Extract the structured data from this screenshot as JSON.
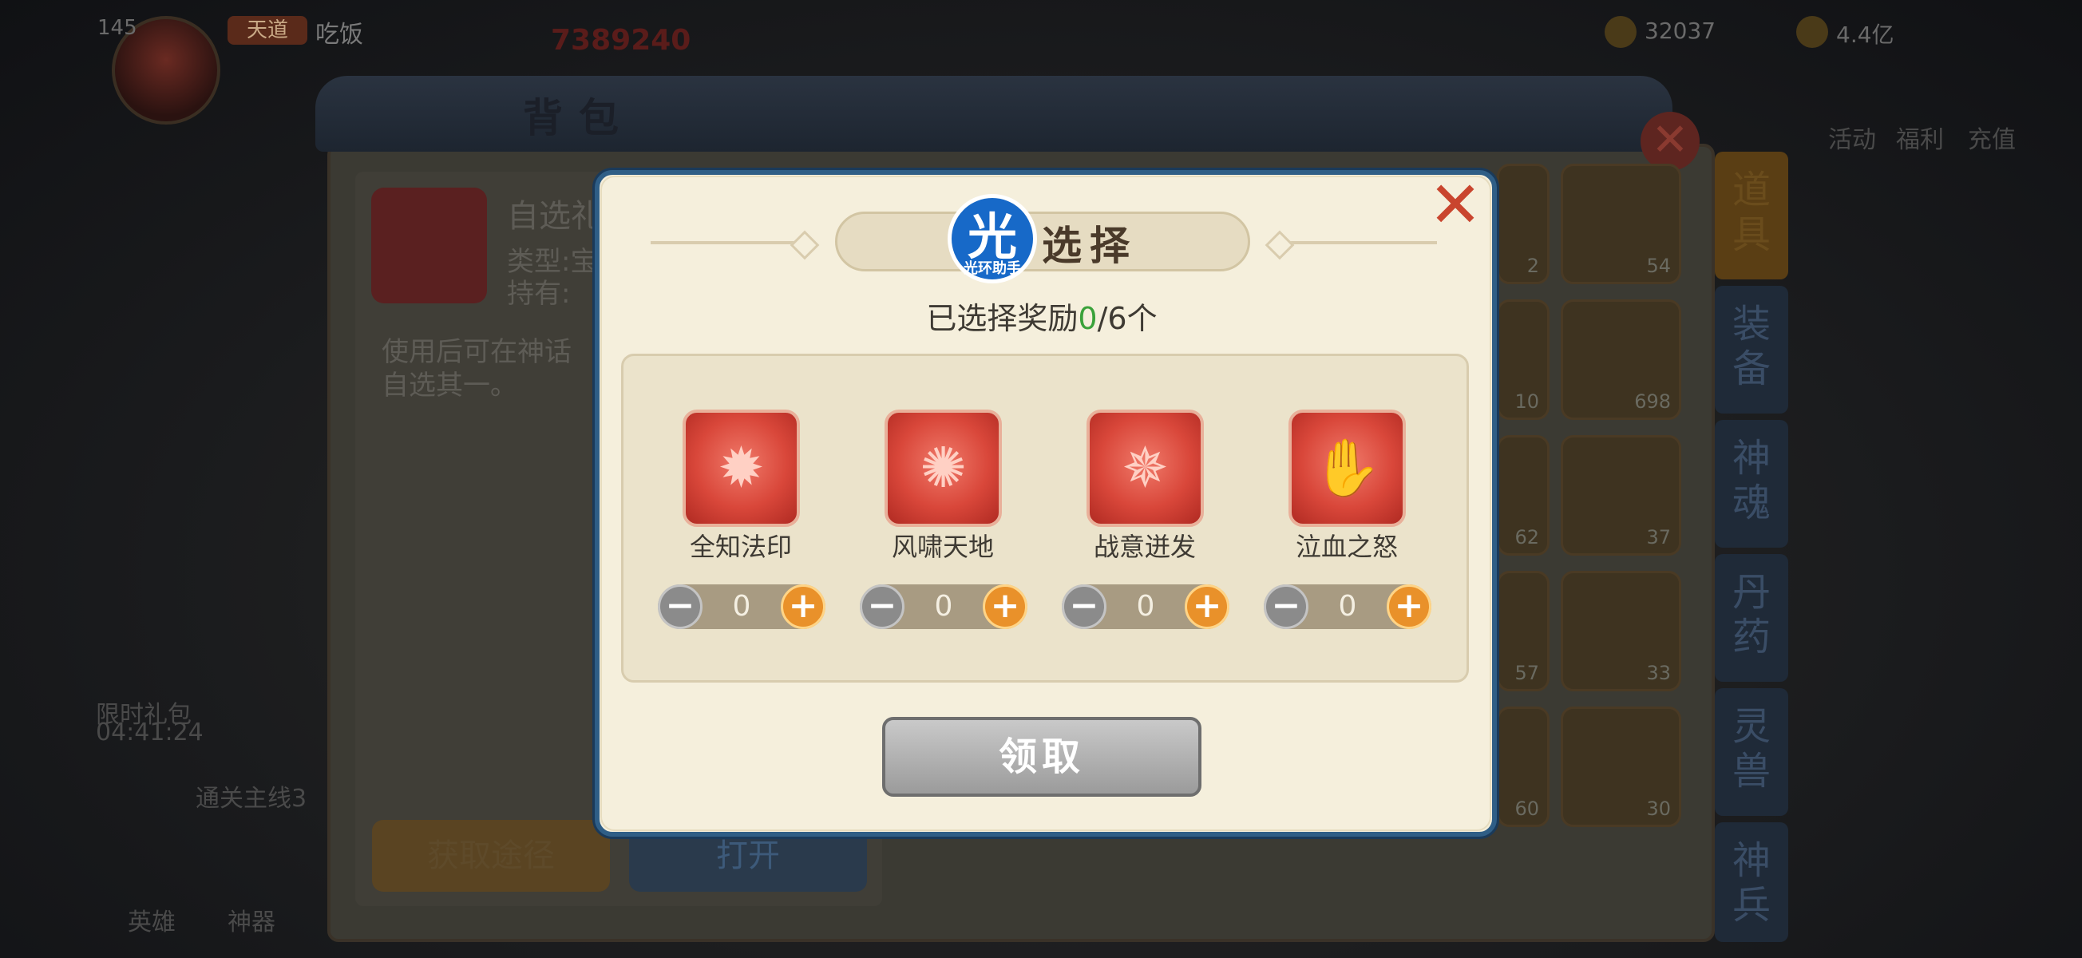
{
  "background": {
    "player_level": "145",
    "player_badge": "天道",
    "player_name": "吃饭",
    "player_id": "7389240",
    "resources": [
      "32037",
      "4.4亿"
    ],
    "bag_title": "背包",
    "item_name": "自选礼",
    "item_type": "类型:宝",
    "item_holder": "持有:",
    "item_desc": "使用后可在神话\n自选其一。",
    "get_way_button": "获取途径",
    "open_button": "打开",
    "grid_counts": [
      "2",
      "54",
      "10",
      "698",
      "62",
      "37",
      "57",
      "33",
      "60",
      "30"
    ],
    "side_tabs": [
      "道具",
      "装备",
      "神魂",
      "丹药",
      "灵兽",
      "神兵"
    ],
    "top_menu": [
      "活动",
      "福利",
      "充值"
    ],
    "left_labels": [
      "限时礼包",
      "04:41:24",
      "通关主线3",
      "英雄",
      "神器"
    ]
  },
  "modal": {
    "title": "选择",
    "logo_char": "光",
    "logo_text": "光环助手",
    "selected_prefix": "已选择奖励",
    "selected_count": "0",
    "selected_suffix": "/6个",
    "rewards": [
      {
        "name": "全知法印",
        "value": "0"
      },
      {
        "name": "风啸天地",
        "value": "0"
      },
      {
        "name": "战意迸发",
        "value": "0"
      },
      {
        "name": "泣血之怒",
        "value": "0"
      }
    ],
    "minus_symbol": "−",
    "plus_symbol": "+",
    "close_symbol": "✕",
    "claim_button": "领取"
  }
}
